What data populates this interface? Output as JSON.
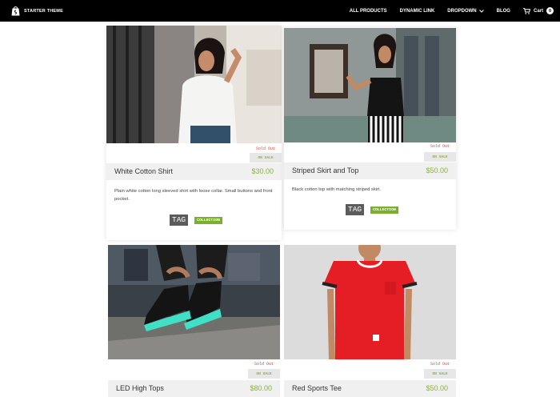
{
  "brand": {
    "name": "STARTER THEME"
  },
  "nav": {
    "items": [
      "ALL PRODUCTS",
      "DYNAMIC LINK",
      "DROPDOWN"
    ],
    "blog": "BLOG",
    "cart_label": "Cart",
    "cart_count": "0"
  },
  "badges": {
    "sold_out": "Sold Out",
    "on_sale": "ON SALE"
  },
  "products": [
    {
      "title": "White Cotton Shirt",
      "price": "$30.00",
      "description": "Plain white cotton long sleeved shirt with loose collar. Small buttons and front pocket.",
      "tag": "TAG",
      "collection": "COLLECTION"
    },
    {
      "title": "Striped Skirt and Top",
      "price": "$50.00",
      "description": "Black cotton top with matching striped skirt.",
      "tag": "TAG",
      "collection": "COLLECTION"
    },
    {
      "title": "LED High Tops",
      "price": "$80.00"
    },
    {
      "title": "Red Sports Tee",
      "price": "$50.00"
    }
  ],
  "colors": {
    "accent_green": "#86b43b",
    "sold_out_red": "#e0433a",
    "topbar": "#000000"
  },
  "icons": {
    "logo": "shopping-bag-icon",
    "dropdown": "chevron-down-icon",
    "cart": "cart-icon"
  }
}
